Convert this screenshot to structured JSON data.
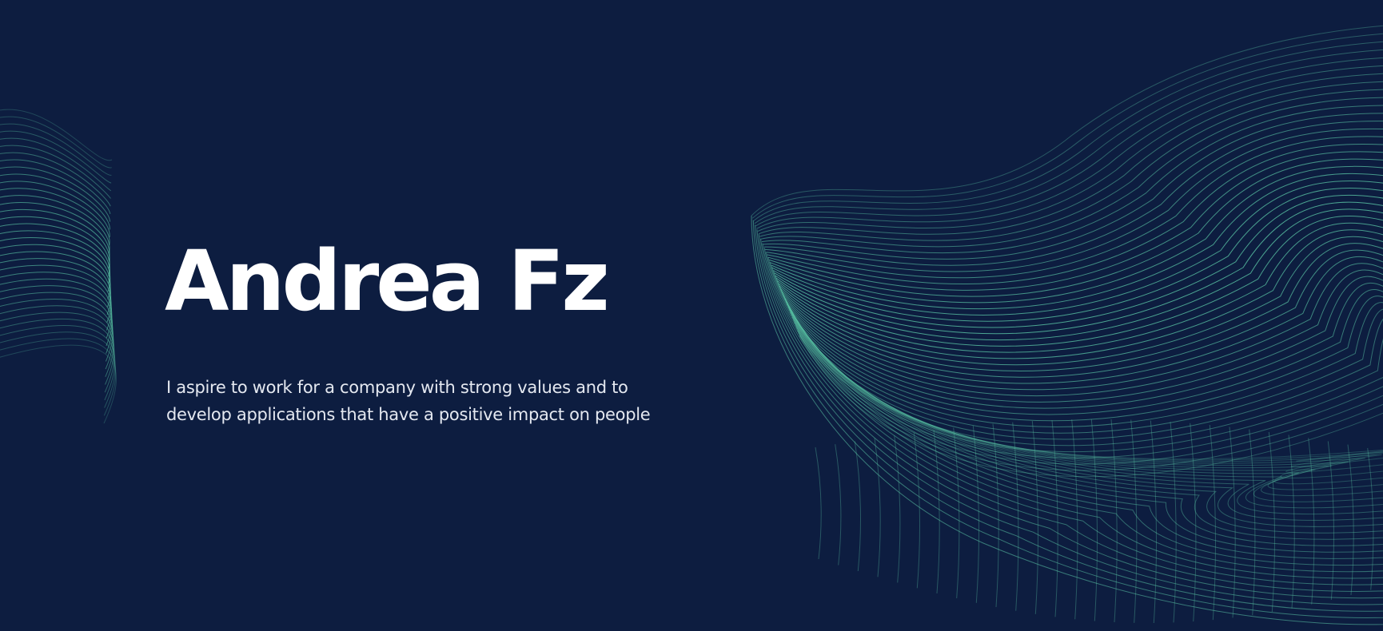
{
  "hero": {
    "name": "Andrea Fz",
    "tagline_line1": "I aspire to work for a company with strong values and to",
    "tagline_line2": "develop applications that have a positive impact on people"
  },
  "theme": {
    "background": "#0d1d40",
    "accent": "#5cc9a7",
    "text": "#ffffff"
  },
  "decorations": {
    "left": "line-wave-graphic",
    "right": "line-wave-graphic"
  }
}
